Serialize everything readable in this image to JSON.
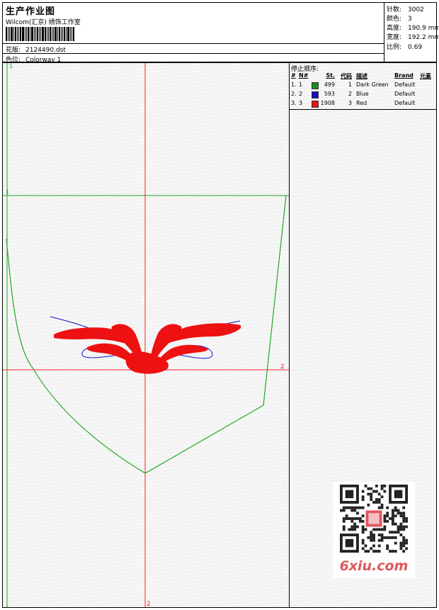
{
  "header": {
    "title": "生产作业图",
    "studio": "Wilcom(汇京) 绣饰工作室",
    "design_label": "花版:",
    "design_value": "2124490.dst",
    "colorway_label": "色位:",
    "colorway_value": "Colorway 1"
  },
  "stats": {
    "stitches_label": "针数:",
    "stitches_value": "3002",
    "colors_label": "颜色:",
    "colors_value": "3",
    "height_label": "高度:",
    "height_value": "190.9 mm",
    "width_label": "宽度:",
    "width_value": "192.2 mm",
    "scale_label": "比例:",
    "scale_value": "0.69"
  },
  "markers": {
    "top_left": "1",
    "frame_left": "1",
    "h_axis_end": "2",
    "v_axis_end": "2"
  },
  "stop_sequence": {
    "title": "停止顺序:",
    "headers": {
      "idx": "#",
      "no": "N#",
      "st": "St.",
      "code": "代码",
      "desc": "描述",
      "brand": "Brand",
      "elem": "元素"
    },
    "rows": [
      {
        "idx": "1.",
        "no": "1",
        "color": "#1a8c1a",
        "st": "499",
        "code": "1",
        "desc": "Dark Green",
        "brand": "Default"
      },
      {
        "idx": "2.",
        "no": "2",
        "color": "#1010cc",
        "st": "593",
        "code": "2",
        "desc": "Blue",
        "brand": "Default"
      },
      {
        "idx": "3.",
        "no": "3",
        "color": "#ee1111",
        "st": "1908",
        "code": "3",
        "desc": "Red",
        "brand": "Default"
      }
    ]
  },
  "watermark": {
    "text": "6xiu.com"
  },
  "colors": {
    "axis": "#ff2020",
    "outline": "#22aa22",
    "blue": "#1010cc",
    "red": "#ee1111"
  }
}
